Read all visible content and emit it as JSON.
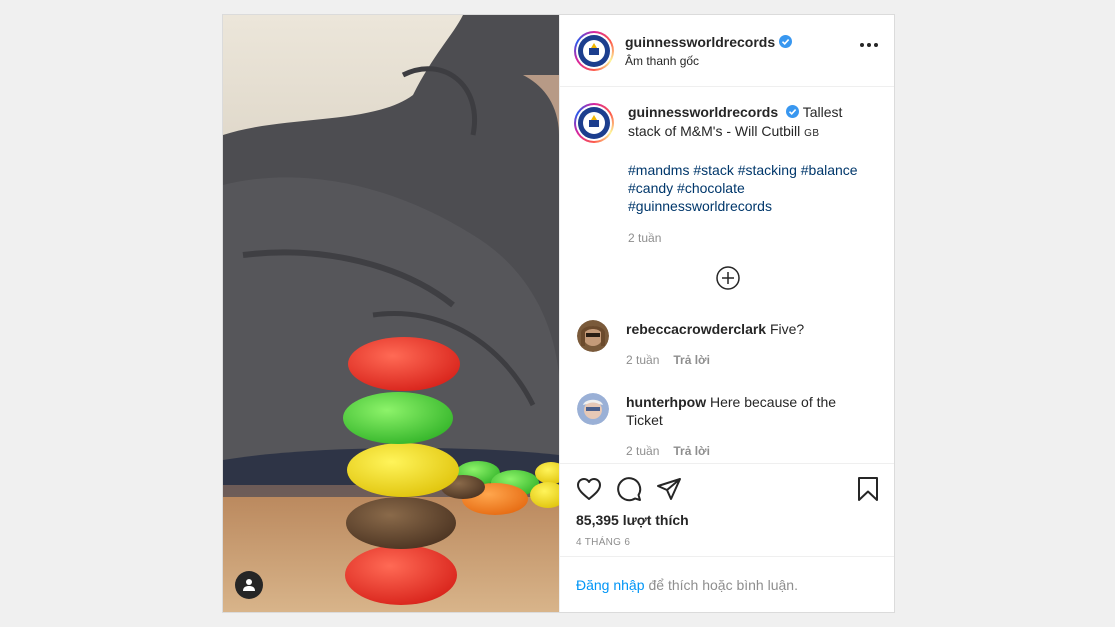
{
  "post": {
    "author": {
      "username": "guinnessworldrecords",
      "verified": true,
      "audio_label": "Âm thanh gốc"
    },
    "caption": {
      "text": "Tallest stack of M&M's - Will Cutbill",
      "flag": "GB",
      "hashtags": [
        "#mandms",
        "#stack",
        "#stacking",
        "#balance",
        "#candy",
        "#chocolate",
        "#guinnessworldrecords"
      ],
      "timestamp": "2 tuần"
    },
    "comments": [
      {
        "username": "rebeccacrowderclark",
        "text": "Five?",
        "timestamp": "2 tuần",
        "reply_label": "Trả lời"
      },
      {
        "username": "hunterhpow",
        "text": "Here because of the Ticket",
        "timestamp": "2 tuần",
        "reply_label": "Trả lời"
      }
    ],
    "likes_text": "85,395 lượt thích",
    "date_text": "4 THÁNG 6",
    "login": {
      "link_text": "Đăng nhập",
      "rest_text": "để thích hoặc bình luận."
    }
  },
  "icons": {
    "more": "more-horizontal-icon",
    "like": "heart-icon",
    "comment": "comment-icon",
    "share": "paper-plane-icon",
    "save": "bookmark-icon",
    "load_more": "plus-circle-icon",
    "user_tag": "user-icon"
  },
  "colors": {
    "link": "#0095f6",
    "hashtag": "#00376b",
    "muted": "#8e8e8e",
    "verified": "#3897f0"
  }
}
